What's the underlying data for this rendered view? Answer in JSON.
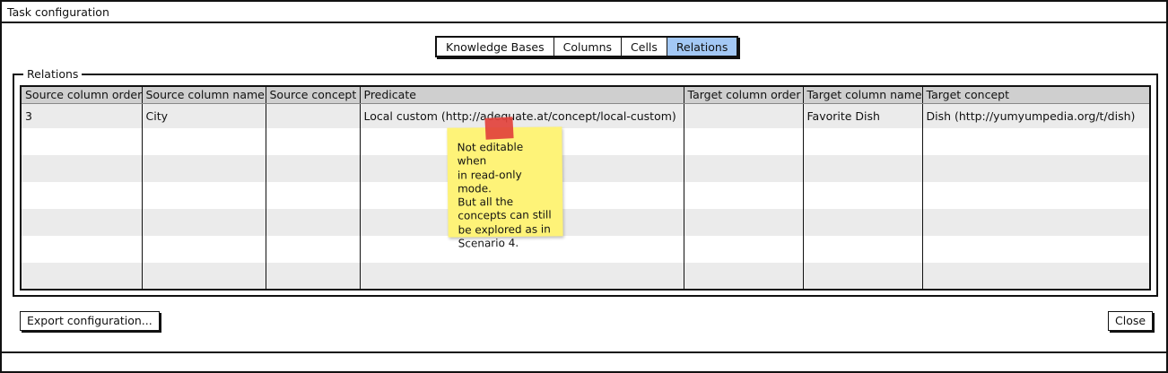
{
  "window": {
    "title": "Task configuration"
  },
  "tabs": [
    {
      "label": "Knowledge Bases",
      "active": false
    },
    {
      "label": "Columns",
      "active": false
    },
    {
      "label": "Cells",
      "active": false
    },
    {
      "label": "Relations",
      "active": true
    }
  ],
  "relations": {
    "legend": "Relations",
    "columns": [
      "Source column order",
      "Source column name",
      "Source concept",
      "Predicate",
      "Target column order",
      "Target column name",
      "Target concept"
    ],
    "rows": [
      [
        "3",
        "City",
        "",
        "Local custom (http://adequate.at/concept/local-custom)",
        "",
        "Favorite Dish",
        "Dish (http://yumyumpedia.org/t/dish)"
      ]
    ]
  },
  "note": {
    "lines": [
      "Not editable when",
      "in read-only mode.",
      "But all the",
      "concepts can still",
      "be explored as in",
      "Scenario 4."
    ]
  },
  "buttons": {
    "export": "Export configuration...",
    "close": "Close"
  },
  "colors": {
    "active_tab": "#a3c8f5",
    "header_bg": "#cfcfcf",
    "row_stripe": "#ebebeb",
    "note_bg": "#fef378",
    "tape": "#e2423c"
  }
}
